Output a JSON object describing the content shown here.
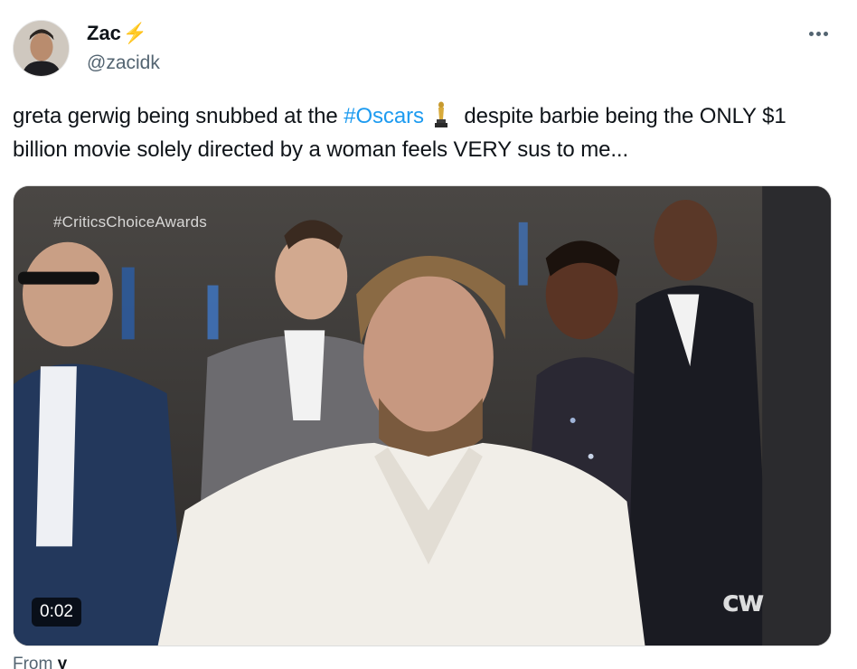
{
  "author": {
    "display_name": "Zac",
    "badge": "⚡",
    "handle": "@zacidk",
    "avatar_icon": "avatar-photo"
  },
  "menu": {
    "icon": "more-horizontal-icon"
  },
  "tweet": {
    "text_part1": "greta gerwig being snubbed at the ",
    "hashtag": "#Oscars",
    "emoji_icon": "trophy-icon",
    "text_part2": " despite barbie being the ONLY $1 billion movie solely directed by a woman feels VERY sus to me..."
  },
  "media": {
    "watermark": "#CriticsChoiceAwards",
    "network_logo": "cw",
    "duration": "0:02"
  },
  "footer": {
    "from_prefix": "From ",
    "from_source": "y"
  },
  "colors": {
    "link": "#1d9bf0",
    "secondary_text": "#536471",
    "primary_text": "#0f1419",
    "bolt": "#f4a11a"
  }
}
